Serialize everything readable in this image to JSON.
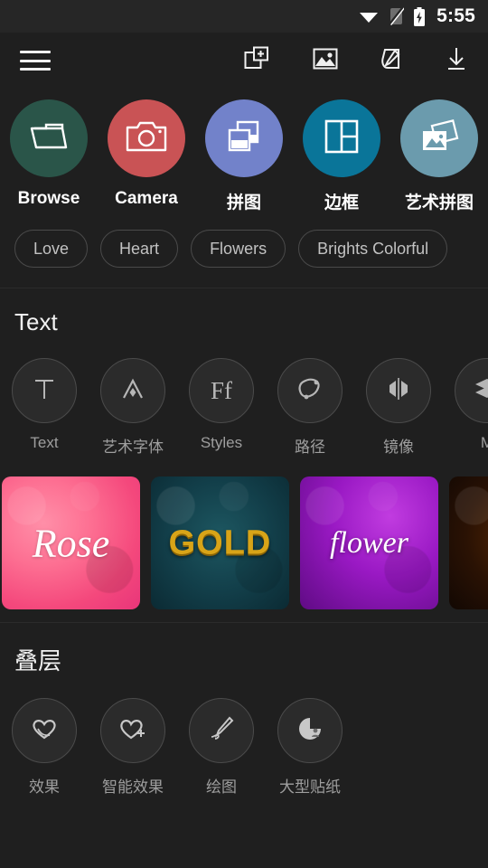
{
  "status_bar": {
    "time": "5:55",
    "icons": [
      "wifi-icon",
      "sim-off-icon",
      "battery-charging-icon"
    ]
  },
  "toolbar": {
    "menu_icon": "hamburger-menu-icon",
    "actions": [
      {
        "name": "add-collage-icon",
        "label": "Add"
      },
      {
        "name": "gallery-icon",
        "label": "Gallery"
      },
      {
        "name": "edit-tag-icon",
        "label": "Edit"
      },
      {
        "name": "download-icon",
        "label": "Download"
      }
    ]
  },
  "categories": [
    {
      "label": "Browse",
      "icon": "folder-icon",
      "color": "#2a5549"
    },
    {
      "label": "Camera",
      "icon": "camera-icon",
      "color": "#c95355"
    },
    {
      "label": "拼图",
      "icon": "collage-icon",
      "color": "#7282ca"
    },
    {
      "label": "边框",
      "icon": "frame-grid-icon",
      "color": "#0a7599"
    },
    {
      "label": "艺术拼图",
      "icon": "art-collage-icon",
      "color": "#6b9bad"
    }
  ],
  "chips": [
    "Love",
    "Heart",
    "Flowers",
    "Brights Colorful"
  ],
  "text_section": {
    "title": "Text",
    "tools": [
      {
        "label": "Text",
        "icon": "letter-t-icon",
        "glyph": "T"
      },
      {
        "label": "艺术字体",
        "icon": "art-font-icon",
        "glyph": "A"
      },
      {
        "label": "Styles",
        "icon": "font-styles-icon",
        "glyph": "Ff"
      },
      {
        "label": "路径",
        "icon": "text-path-icon",
        "glyph": "◯"
      },
      {
        "label": "镜像",
        "icon": "mirror-icon",
        "glyph": "▶◀"
      },
      {
        "label": "M",
        "icon": "layers-icon",
        "glyph": "≋"
      }
    ],
    "thumbnails": [
      {
        "label": "Rose",
        "style": "t-rose",
        "name": "thumbnail-rose"
      },
      {
        "label": "GOLD",
        "style": "t-gold",
        "name": "thumbnail-gold"
      },
      {
        "label": "flower",
        "style": "t-flower",
        "name": "thumbnail-flower"
      },
      {
        "label": "",
        "style": "t-fire",
        "name": "thumbnail-fire"
      }
    ]
  },
  "overlay_section": {
    "title": "叠层",
    "tools": [
      {
        "label": "效果",
        "icon": "heart-outline-icon"
      },
      {
        "label": "智能效果",
        "icon": "heart-sparkle-icon"
      },
      {
        "label": "绘图",
        "icon": "brush-icon"
      },
      {
        "label": "大型贴纸",
        "icon": "sticker-badge-icon"
      }
    ]
  },
  "theme": {
    "background": "#1f1f1f",
    "statusbar_background": "#262626",
    "text_primary": "#ffffff",
    "text_secondary": "#9e9e9e",
    "chip_border": "#4a4a4a"
  }
}
